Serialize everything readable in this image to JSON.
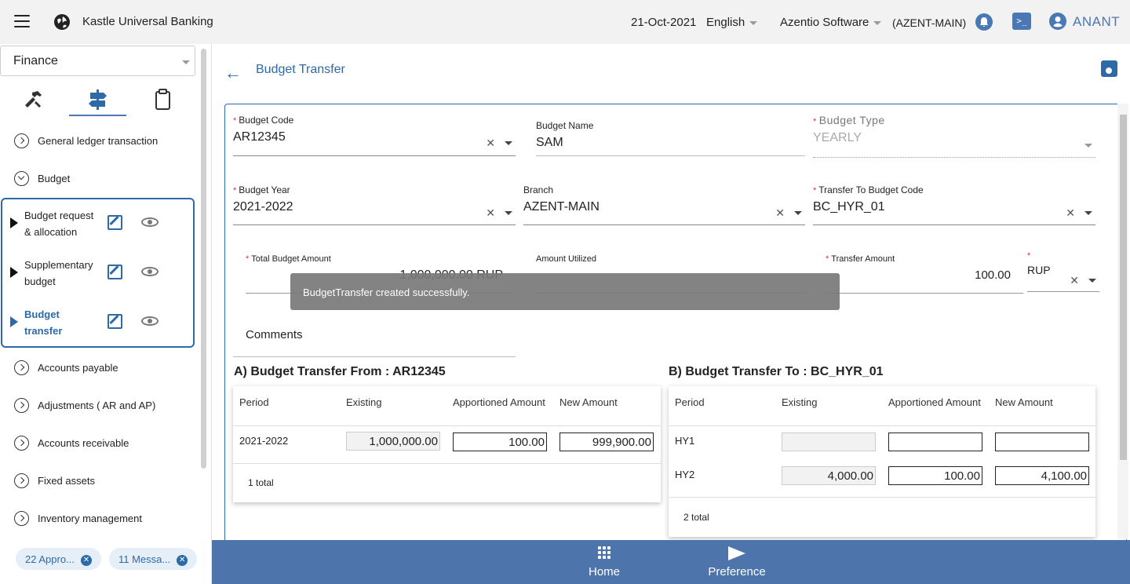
{
  "topbar": {
    "app_title": "Kastle Universal Banking",
    "date": "21-Oct-2021",
    "language": "English",
    "company": "Azentio Software",
    "branch": "(AZENT-MAIN)",
    "user": "ANANT",
    "icons": [
      "menu-icon",
      "globe-icon",
      "bell-icon",
      "terminal-icon",
      "user-icon"
    ]
  },
  "sidebar": {
    "module": "Finance",
    "tab_icons": [
      "tools-icon",
      "signpost-icon",
      "clipboard-icon"
    ],
    "items": [
      {
        "label": "General ledger transaction"
      },
      {
        "label": "Budget"
      },
      {
        "label": "Accounts payable"
      },
      {
        "label": "Adjustments ( AR and AP)"
      },
      {
        "label": "Accounts receivable"
      },
      {
        "label": "Fixed assets"
      },
      {
        "label": "Inventory management"
      }
    ],
    "budget_children": [
      {
        "label": "Budget request & allocation"
      },
      {
        "label": "Supplementary budget"
      },
      {
        "label": "Budget transfer"
      }
    ],
    "chips": [
      {
        "label": "22 Appro..."
      },
      {
        "label": "11 Messa..."
      }
    ]
  },
  "page": {
    "title": "Budget Transfer"
  },
  "form": {
    "budget_code": {
      "label": "Budget Code",
      "value": "AR12345"
    },
    "budget_name": {
      "label": "Budget Name",
      "value": "SAM"
    },
    "budget_type": {
      "label": "Budget Type",
      "value": "YEARLY"
    },
    "budget_year": {
      "label": "Budget Year",
      "value": "2021-2022"
    },
    "branch": {
      "label": "Branch",
      "value": "AZENT-MAIN"
    },
    "transfer_to": {
      "label": "Transfer To Budget Code",
      "value": "BC_HYR_01"
    },
    "total_budget": {
      "label": "Total Budget Amount",
      "value": "1,000,000.00 RUP"
    },
    "amount_utilized": {
      "label": "Amount Utilized",
      "value": ""
    },
    "transfer_amount": {
      "label": "Transfer Amount",
      "value": "100.00"
    },
    "currency": {
      "value": "RUP"
    },
    "comments": {
      "label": "Comments"
    }
  },
  "toast": "BudgetTransfer created successfully.",
  "table_from": {
    "title": "A) Budget Transfer From : AR12345",
    "headers": [
      "Period",
      "Existing",
      "Apportioned Amount",
      "New Amount"
    ],
    "rows": [
      {
        "period": "2021-2022",
        "existing": "1,000,000.00",
        "apportioned": "100.00",
        "new": "999,900.00"
      }
    ],
    "total": "1 total"
  },
  "table_to": {
    "title": "B) Budget Transfer To : BC_HYR_01",
    "headers": [
      "Period",
      "Existing",
      "Apportioned Amount",
      "New Amount"
    ],
    "rows": [
      {
        "period": "HY1",
        "existing": "",
        "apportioned": "",
        "new": ""
      },
      {
        "period": "HY2",
        "existing": "4,000.00",
        "apportioned": "100.00",
        "new": "4,100.00"
      }
    ],
    "total": "2 total"
  },
  "bottombar": {
    "home": "Home",
    "preference": "Preference"
  }
}
